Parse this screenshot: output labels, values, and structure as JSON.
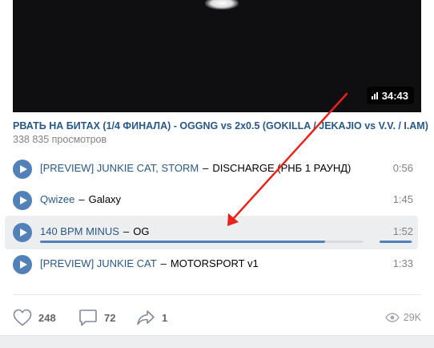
{
  "video": {
    "duration": "34:43",
    "title": "РВАТЬ НА БИТАХ (1/4 ФИНАЛА) - OGGNG vs 2x0.5 (GOKILLA / JEKAJIO vs V.V. / I.AM)",
    "views": "338 835 просмотров"
  },
  "tracks": [
    {
      "artist": "[PREVIEW] JUNKIE CAT, STORM",
      "title": "DISCHARGE (РНБ 1 РАУНД)",
      "duration": "0:56"
    },
    {
      "artist": "Qwizee",
      "title": "Galaxy",
      "duration": "1:45"
    },
    {
      "artist": "140 BPM MINUS",
      "title": "OG",
      "duration": "1:52",
      "active": true,
      "progress": 0.88,
      "volume": 0.95
    },
    {
      "artist": "[PREVIEW] JUNKIE CAT",
      "title": "MOTORSPORT v1",
      "duration": "1:33"
    }
  ],
  "separator": "–",
  "actions": {
    "likes": "248",
    "comments": "72",
    "shares": "1",
    "views": "29K"
  },
  "colors": {
    "accent": "#5181b8",
    "link": "#2a5885",
    "annotation_arrow": "#e8231b"
  }
}
